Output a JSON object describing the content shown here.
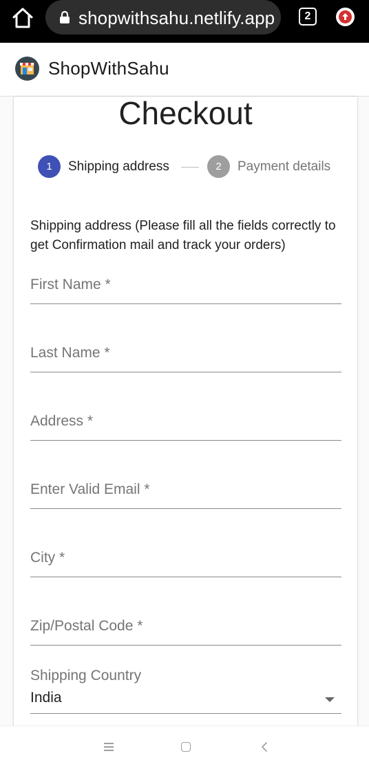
{
  "browser": {
    "url": "shopwithsahu.netlify.app",
    "tab_count": "2",
    "icons": [
      "home-icon",
      "lock-icon",
      "tabs-icon",
      "update-icon"
    ]
  },
  "app": {
    "brand": "ShopWithSahu",
    "logo_icon": "storefront-icon"
  },
  "checkout": {
    "title": "Checkout",
    "steps": [
      {
        "number": "1",
        "label": "Shipping address",
        "active": true
      },
      {
        "number": "2",
        "label": "Payment details",
        "active": false
      }
    ],
    "instructions": "Shipping address (Please fill all the fields correctly to get Confirmation mail and track your orders)",
    "fields": [
      {
        "label": "First Name *",
        "value": ""
      },
      {
        "label": "Last Name *",
        "value": ""
      },
      {
        "label": "Address *",
        "value": ""
      },
      {
        "label": "Enter Valid Email *",
        "value": ""
      },
      {
        "label": "City *",
        "value": ""
      },
      {
        "label": "Zip/Postal Code *",
        "value": ""
      }
    ],
    "country": {
      "label": "Shipping Country",
      "value": "India"
    }
  },
  "colors": {
    "primary": "#3f51b5",
    "inactive_step": "#9e9e9e",
    "update_badge": "#d3302f"
  },
  "system_nav": {
    "icons": [
      "menu-icon",
      "home-square-icon",
      "back-icon"
    ]
  }
}
